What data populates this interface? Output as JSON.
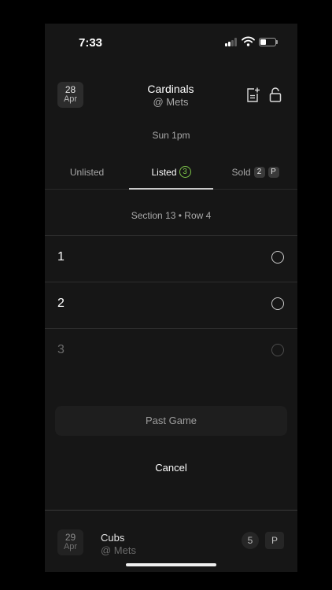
{
  "status_bar": {
    "time": "7:33",
    "signal_level": 2,
    "battery_level": 0.4
  },
  "header": {
    "date": {
      "day": "28",
      "month": "Apr"
    },
    "title": "Cardinals",
    "opponent": "@ Mets",
    "time": "Sun 1pm",
    "icons": [
      "add-note-icon",
      "unlock-icon"
    ]
  },
  "tabs": [
    {
      "label": "Unlisted",
      "selected": false
    },
    {
      "label": "Listed",
      "count": "3",
      "selected": true
    },
    {
      "label": "Sold",
      "count": "2",
      "badge": "P",
      "selected": false
    }
  ],
  "section_info": "Section 13 • Row 4",
  "seats": [
    {
      "number": "1",
      "enabled": true
    },
    {
      "number": "2",
      "enabled": true
    },
    {
      "number": "3",
      "enabled": false
    }
  ],
  "actions": {
    "past_game": "Past Game",
    "cancel": "Cancel"
  },
  "next_game": {
    "date": {
      "day": "29",
      "month": "Apr"
    },
    "title": "Cubs",
    "opponent": "@ Mets",
    "count": "5",
    "badge": "P"
  },
  "colors": {
    "background": "#161616",
    "accent_green": "#7ec54a",
    "text_secondary": "#a8a8a8"
  }
}
